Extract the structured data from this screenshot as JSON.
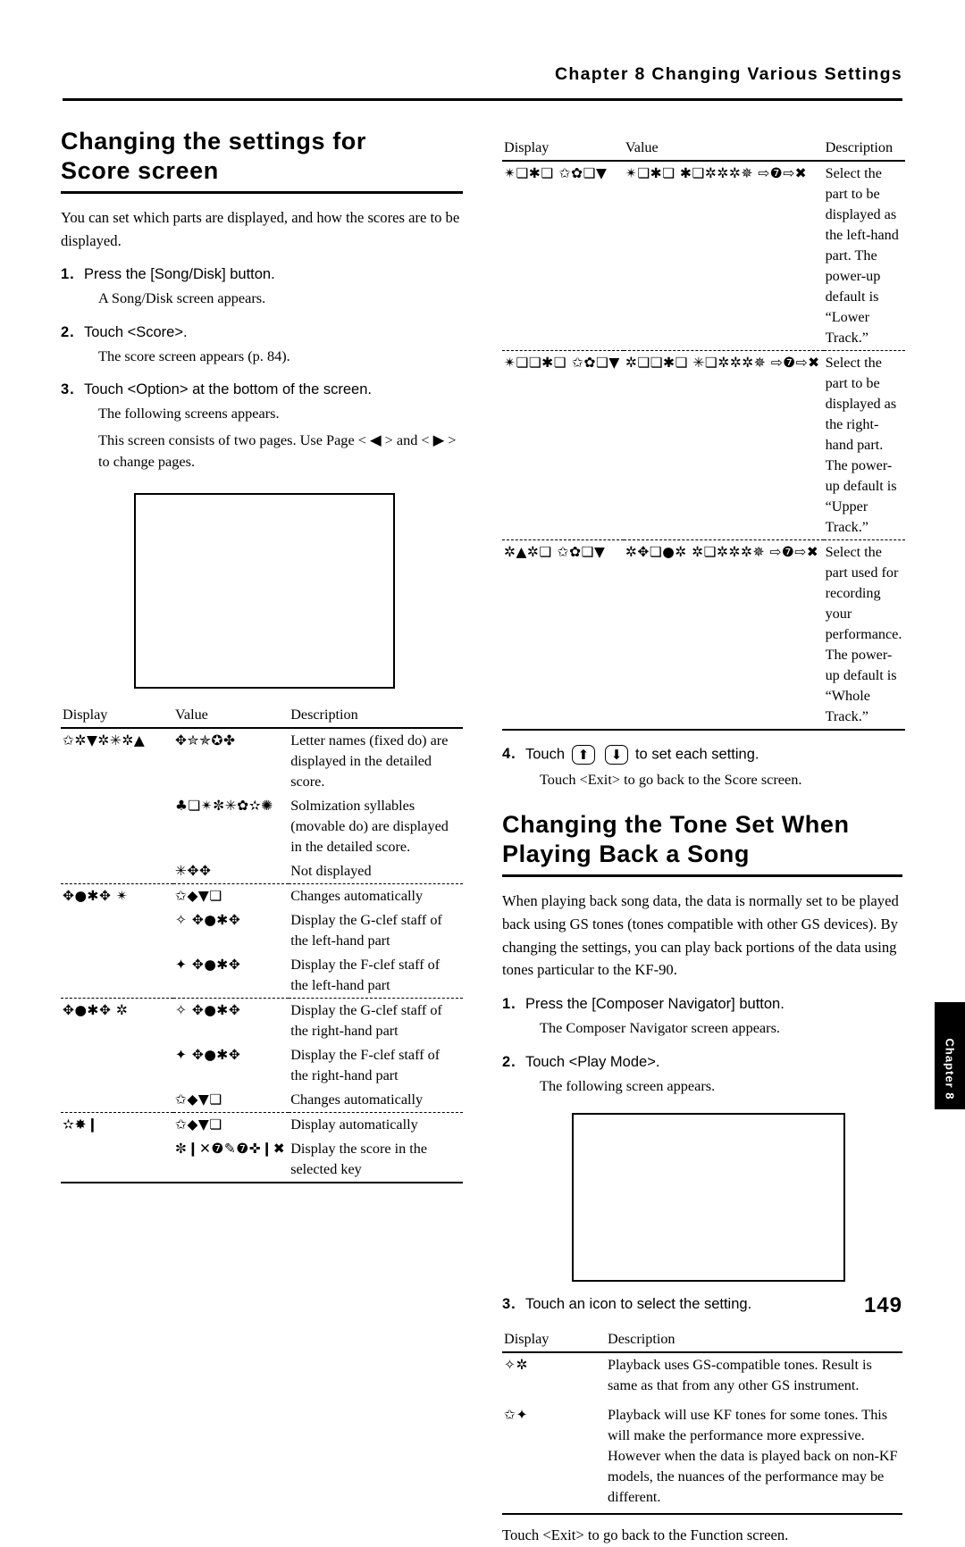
{
  "header": {
    "chapter_line": "Chapter 8 Changing Various Settings"
  },
  "left": {
    "title": "Changing the settings for\nScore screen",
    "intro": "You can set which parts are displayed, and how the scores are to be displayed.",
    "steps": [
      {
        "num": "1.",
        "text": "Press the [Song/Disk] button.",
        "sub": [
          "A Song/Disk screen appears."
        ]
      },
      {
        "num": "2.",
        "text": "Touch <Score>.",
        "sub": [
          "The score screen appears (p. 84)."
        ]
      },
      {
        "num": "3.",
        "text": "Touch <Option> at the bottom of the screen.",
        "sub": [
          "The following screens appears.",
          "This screen consists of two pages. Use Page < ◀ > and < ▶ > to change pages."
        ]
      }
    ],
    "table": {
      "headers": [
        "Display",
        "Value",
        "Description"
      ],
      "rows": [
        {
          "display": "✩✲▼✲✳✲▲",
          "value": "✥✮✯✪✤",
          "description": "Letter names (fixed do) are displayed in the detailed score."
        },
        {
          "display": "",
          "value": "♣❏✴✼✳✿✫✺",
          "description": "Solmization syllables (movable do) are displayed in the detailed score."
        },
        {
          "display": "",
          "value": "✳✥✥",
          "description": "Not displayed"
        },
        {
          "display": "✥●✱✥ ✴",
          "value": "✩◆▼❏",
          "description": "Changes automatically"
        },
        {
          "display": "",
          "value": "✧ ✥●✱✥",
          "description": "Display the G-clef staff of the left-hand part"
        },
        {
          "display": "",
          "value": "✦ ✥●✱✥",
          "description": "Display the F-clef staff of the left-hand part"
        },
        {
          "display": "✥●✱✥ ✲",
          "value": "✧ ✥●✱✥",
          "description": "Display the G-clef staff of the right-hand part"
        },
        {
          "display": "",
          "value": "✦ ✥●✱✥",
          "description": "Display the F-clef staff of the right-hand part"
        },
        {
          "display": "",
          "value": "✩◆▼❏",
          "description": "Changes automatically"
        },
        {
          "display": "✫✸❙",
          "value": "✩◆▼❏",
          "description": "Display automatically"
        },
        {
          "display": "",
          "value": "✼❙✕❼✎❼✜❙✖",
          "description": "Display the score in the selected key"
        }
      ]
    }
  },
  "right": {
    "table1": {
      "headers": [
        "Display",
        "Value",
        "Description"
      ],
      "rows": [
        {
          "display": "✴❏✱❏ ✩✿❏▼",
          "value": "✴❏✱❏ ✱❏✲✲✲✵ ⇨❼⇨✖",
          "description": "Select the part to be displayed as the left-hand part. The power-up default is “Lower Track.”"
        },
        {
          "display": "✴❏❏✱❏ ✩✿❏▼",
          "value": "✲❏❏✱❏ ✳❏✲✲✲✵ ⇨❼⇨✖",
          "description": "Select the part to be displayed as the right-hand part. The power-up default is “Upper Track.”"
        },
        {
          "display": "✲▲✲❏ ✩✿❏▼",
          "value": "✲✥❏●✲ ✲❏✲✲✲✵ ⇨❼⇨✖",
          "description": "Select the part used for recording your performance. The power-up default is “Whole Track.”"
        }
      ]
    },
    "step4": {
      "num": "4.",
      "text_before": "Touch",
      "icon1": "⬆",
      "icon2": "⬇",
      "text_after": "to set each setting.",
      "sub": "Touch <Exit> to go back to the Score screen."
    },
    "title2": "Changing the Tone Set When\nPlaying Back a Song",
    "intro2": "When playing back song data, the data is normally set to be played back using GS tones (tones compatible with other GS devices). By changing the settings, you can play back portions of the data using tones particular to the KF-90.",
    "steps2": [
      {
        "num": "1.",
        "text": "Press the [Composer Navigator] button.",
        "sub": [
          "The Composer Navigator screen appears."
        ]
      },
      {
        "num": "2.",
        "text": "Touch <Play Mode>.",
        "sub": [
          "The following screen appears."
        ]
      },
      {
        "num": "3.",
        "text": "Touch an icon to select the setting.",
        "sub": []
      }
    ],
    "table2": {
      "headers": [
        "Display",
        "Description"
      ],
      "rows": [
        {
          "display": "✧✲",
          "description": "Playback uses GS-compatible tones. Result is same as that from any other GS instrument."
        },
        {
          "display": "✩✦",
          "description": "Playback will use KF tones for some tones. This will make the performance more expressive. However when the data is played back on non-KF models, the nuances of the performance may be different."
        }
      ]
    },
    "closing": "Touch <Exit> to go back to the Function screen."
  },
  "chapter_tab": "Chapter 8",
  "page_number": "149"
}
